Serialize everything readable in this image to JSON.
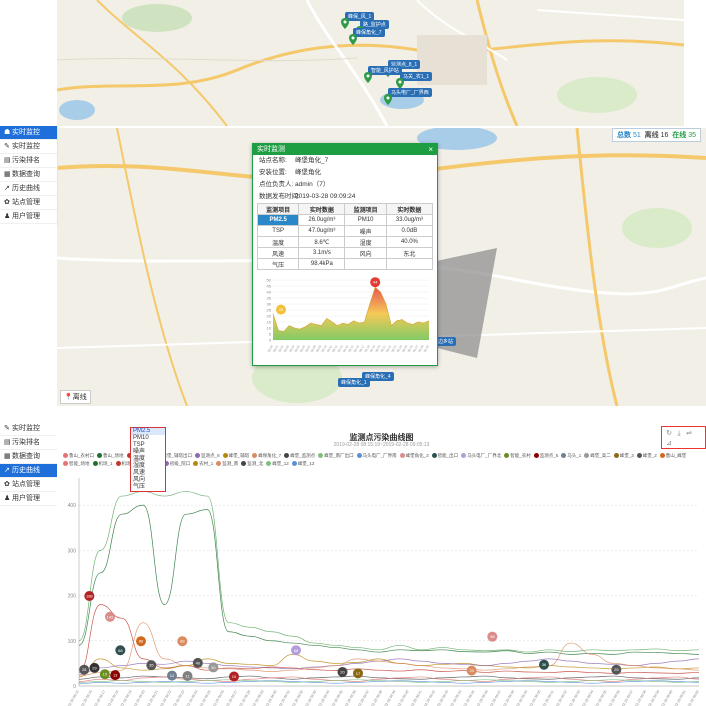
{
  "map_top": {
    "markers": [
      {
        "label": "峰保_风_1",
        "x": 345,
        "y": 12
      },
      {
        "label": "路_监护点",
        "x": 360,
        "y": 20
      },
      {
        "label": "峰保角化_7",
        "x": 353,
        "y": 28
      },
      {
        "label": "监测点_8_1",
        "x": 388,
        "y": 60
      },
      {
        "label": "智能_风护站",
        "x": 368,
        "y": 66
      },
      {
        "label": "马关_农1_1",
        "x": 400,
        "y": 72
      },
      {
        "label": "马头电厂_厂界西",
        "x": 388,
        "y": 88
      }
    ]
  },
  "sidebar": {
    "items": [
      {
        "icon": "☗",
        "label": "实时监控"
      },
      {
        "icon": "✎",
        "label": "实时监控"
      },
      {
        "icon": "▤",
        "label": "污染排名"
      },
      {
        "icon": "▦",
        "label": "数据查询"
      },
      {
        "icon": "↗",
        "label": "历史曲线"
      },
      {
        "icon": "✿",
        "label": "站点管理"
      },
      {
        "icon": "♟",
        "label": "用户管理"
      }
    ]
  },
  "status": {
    "total_label": "总数",
    "total": "51",
    "offline_label": "离线",
    "offline": "16",
    "online_label": "在线",
    "online": "35"
  },
  "map_mid": {
    "legend_offline": "离线",
    "marker_labels": [
      "峰保角化_4",
      "峰保角化_1",
      "路边乡站"
    ]
  },
  "popup": {
    "title": "实时监测",
    "close": "×",
    "info": [
      {
        "k": "站点名称:",
        "v": "峰堡角化_7"
      },
      {
        "k": "安装位置:",
        "v": "峰堡角化"
      },
      {
        "k": "点位负责人:",
        "v": "admin（7）"
      },
      {
        "k": "数据发布时间:",
        "v": "2019-03-28 09:09:24"
      }
    ],
    "table_header": [
      "监测项目",
      "实时数据",
      "监测项目",
      "实时数据"
    ],
    "rows": [
      [
        "PM2.5",
        "26.0ug/m³",
        "PM10",
        "33.0ug/m³"
      ],
      [
        "TSP",
        "47.0ug/m³",
        "噪声",
        "0.0dB"
      ],
      [
        "温度",
        "8.6℃",
        "湿度",
        "40.0%"
      ],
      [
        "风速",
        "3.1m/s",
        "风向",
        "东北"
      ],
      [
        "气压",
        "98.4kPa",
        "",
        ""
      ]
    ],
    "mini_chart": {
      "yticks": [
        "50",
        "45",
        "40",
        "35",
        "30",
        "25",
        "20",
        "15",
        "10",
        "5",
        "0"
      ],
      "values": [
        22,
        8,
        7,
        12,
        10,
        9,
        11,
        14,
        13,
        12,
        18,
        15,
        12,
        14,
        13,
        16,
        14,
        15,
        30,
        44,
        40,
        30,
        12,
        16,
        17,
        14,
        13,
        15,
        14,
        16
      ],
      "max_label": "44",
      "min_label": "22"
    }
  },
  "bottom": {
    "nav": [
      {
        "icon": "✎",
        "label": "实时监控"
      },
      {
        "icon": "▤",
        "label": "污染排名"
      },
      {
        "icon": "▦",
        "label": "数据查询"
      },
      {
        "icon": "↗",
        "label": "历史曲线"
      },
      {
        "icon": "✿",
        "label": "站点管理"
      },
      {
        "icon": "♟",
        "label": "用户管理"
      }
    ],
    "dropdown": [
      "PM2.5",
      "PM10",
      "TSP",
      "噪声",
      "温度",
      "湿度",
      "风速",
      "风向",
      "气压"
    ],
    "tools": [
      "↻",
      "⤓",
      "⇌",
      "⊿"
    ]
  },
  "chart_data": {
    "type": "line",
    "title": "监测点污染曲线图",
    "subtitle": "2019-02-28 08:15:19~2019-02-28 09:05:13",
    "yticks": [
      "400",
      "300",
      "200",
      "100",
      "0"
    ],
    "ylim": [
      0,
      460
    ],
    "legend": [
      "鲁山_农村口",
      "鲁山_场地",
      "峰堡_机_6",
      "峰堡_辅塔出口",
      "监测点_8",
      "峰堡_辅塔",
      "峰保角化_7",
      "峰堡_监测点",
      "峰堡_南厂出口",
      "马头电厂_厂界南",
      "峰堡角化_3",
      "智能_出口",
      "马头电厂_厂界北",
      "智能_农村",
      "监测点_5",
      "马头_1",
      "峰堡_高二",
      "峰堡_3",
      "峰堡_2",
      "鲁山_峰堡",
      "智能_场地",
      "机场_1",
      "机场_2",
      "峰堡_11",
      "初级_院口",
      "农村_1",
      "监测_南",
      "监测_北",
      "峰堡_12",
      "峰堡_13"
    ],
    "series": [
      {
        "color": "#58a55c",
        "values": [
          100,
          300,
          420,
          430,
          420,
          430,
          420,
          140,
          130,
          120,
          110,
          95,
          90,
          85,
          80,
          90,
          80,
          85,
          80,
          78,
          80,
          75,
          80,
          76,
          80,
          78,
          80,
          82,
          78,
          80
        ]
      },
      {
        "color": "#1f6f2f",
        "values": [
          90,
          250,
          380,
          400,
          180,
          380,
          390,
          120,
          110,
          100,
          95,
          90,
          85,
          80,
          75,
          80,
          78,
          80,
          76,
          75,
          78,
          72,
          75,
          70,
          72,
          70,
          75,
          74,
          72,
          70
        ]
      },
      {
        "color": "#c0392b",
        "values": [
          30,
          180,
          150,
          60,
          40,
          45,
          35,
          40,
          38,
          42,
          40,
          36,
          34,
          38,
          35,
          33,
          36,
          32,
          34,
          30,
          33,
          31,
          30,
          32,
          30,
          28,
          30,
          29,
          28,
          30
        ]
      },
      {
        "color": "#b8860b",
        "values": [
          20,
          60,
          40,
          35,
          38,
          45,
          60,
          50,
          48,
          45,
          70,
          55,
          50,
          52,
          60,
          50,
          45,
          48,
          50,
          45,
          42,
          40,
          45,
          42,
          40,
          38,
          40,
          42,
          38,
          40
        ]
      },
      {
        "color": "#8e6ab0",
        "values": [
          25,
          40,
          45,
          50,
          48,
          55,
          50,
          45,
          42,
          40,
          38,
          42,
          45,
          50,
          55,
          60,
          55,
          50,
          48,
          45,
          50,
          55,
          60,
          55,
          50,
          48,
          45,
          50,
          55,
          60
        ]
      },
      {
        "color": "#d98c5f",
        "values": [
          22,
          30,
          35,
          140,
          60,
          45,
          40,
          38,
          35,
          32,
          35,
          40,
          45,
          60,
          55,
          50,
          45,
          40,
          38,
          35,
          38,
          42,
          45,
          95,
          70,
          50,
          45,
          40,
          38,
          35
        ]
      },
      {
        "color": "#444444",
        "values": [
          15,
          20,
          18,
          22,
          20,
          18,
          16,
          20,
          22,
          18,
          15,
          18,
          20,
          22,
          18,
          16,
          15,
          18,
          20,
          22,
          18,
          16,
          15,
          18,
          20,
          22,
          18,
          16,
          15,
          18
        ]
      },
      {
        "color": "#e57373",
        "values": [
          10,
          15,
          12,
          18,
          20,
          15,
          12,
          10,
          15,
          18,
          20,
          15,
          12,
          10,
          15,
          18,
          20,
          15,
          12,
          10,
          15,
          18,
          20,
          15,
          12,
          10,
          15,
          18,
          20,
          15
        ]
      },
      {
        "color": "#7fbf7f",
        "values": [
          8,
          10,
          12,
          10,
          8,
          10,
          12,
          14,
          12,
          10,
          8,
          10,
          12,
          14,
          12,
          10,
          8,
          10,
          12,
          14,
          12,
          10,
          8,
          10,
          12,
          14,
          12,
          10,
          8,
          10
        ]
      },
      {
        "color": "#5b8fd6",
        "values": [
          5,
          8,
          6,
          8,
          10,
          8,
          6,
          8,
          10,
          12,
          10,
          8,
          6,
          8,
          10,
          12,
          10,
          8,
          6,
          8,
          10,
          12,
          10,
          8,
          6,
          8,
          10,
          12,
          10,
          8
        ]
      }
    ],
    "bubbles": [
      {
        "label": "188",
        "color": "#b22222",
        "x": 1,
        "y": 188
      },
      {
        "label": "142",
        "color": "#d98c8c",
        "x": 3,
        "y": 142
      },
      {
        "label": "88",
        "color": "#d2691e",
        "x": 6,
        "y": 88
      },
      {
        "label": "88",
        "color": "#d98c5f",
        "x": 10,
        "y": 88
      },
      {
        "label": "68",
        "color": "#b39ddb",
        "x": 21,
        "y": 68
      },
      {
        "label": "68",
        "color": "#2f4f4f",
        "x": 4,
        "y": 68
      },
      {
        "label": "25",
        "color": "#555555",
        "x": 0.5,
        "y": 25
      },
      {
        "label": "29",
        "color": "#333333",
        "x": 1.5,
        "y": 29
      },
      {
        "label": "15",
        "color": "#6b8e23",
        "x": 2.5,
        "y": 15
      },
      {
        "label": "13",
        "color": "#8b0000",
        "x": 3.5,
        "y": 13
      },
      {
        "label": "35",
        "color": "#555555",
        "x": 7,
        "y": 35
      },
      {
        "label": "12",
        "color": "#708090",
        "x": 9,
        "y": 12
      },
      {
        "label": "11",
        "color": "#808080",
        "x": 10.5,
        "y": 11
      },
      {
        "label": "10",
        "color": "#b22222",
        "x": 15,
        "y": 10
      },
      {
        "label": "30",
        "color": "#999999",
        "x": 13,
        "y": 30
      },
      {
        "label": "40",
        "color": "#555555",
        "x": 11.5,
        "y": 40
      },
      {
        "label": "17",
        "color": "#8b6914",
        "x": 27,
        "y": 17
      },
      {
        "label": "20",
        "color": "#444444",
        "x": 25.5,
        "y": 20
      },
      {
        "label": "23",
        "color": "#d98c5f",
        "x": 38,
        "y": 23
      },
      {
        "label": "36",
        "color": "#2f4f4f",
        "x": 45,
        "y": 36
      },
      {
        "label": "25",
        "color": "#555555",
        "x": 52,
        "y": 25
      },
      {
        "label": "98",
        "color": "#d98c8c",
        "x": 40,
        "y": 98
      }
    ]
  }
}
